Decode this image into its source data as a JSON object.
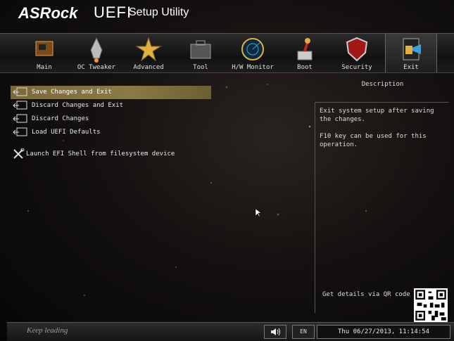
{
  "header": {
    "brand": "ASRock",
    "uefi": "UEFI",
    "subtitle": "Setup Utility"
  },
  "tabs": [
    {
      "label": "Main",
      "icon": "board-icon"
    },
    {
      "label": "OC Tweaker",
      "icon": "rocket-icon"
    },
    {
      "label": "Advanced",
      "icon": "star-icon"
    },
    {
      "label": "Tool",
      "icon": "toolbox-icon"
    },
    {
      "label": "H/W Monitor",
      "icon": "radar-icon"
    },
    {
      "label": "Boot",
      "icon": "joystick-icon"
    },
    {
      "label": "Security",
      "icon": "shield-icon"
    },
    {
      "label": "Exit",
      "icon": "exit-door-icon",
      "active": true
    }
  ],
  "menu": {
    "items": [
      {
        "label": "Save Changes and Exit",
        "icon": "exit-arrow-icon",
        "selected": true
      },
      {
        "label": "Discard Changes and Exit",
        "icon": "exit-arrow-icon"
      },
      {
        "label": "Discard Changes",
        "icon": "exit-arrow-icon"
      },
      {
        "label": "Load UEFI Defaults",
        "icon": "exit-arrow-icon"
      },
      {
        "label": "Launch EFI Shell from filesystem device",
        "icon": "wrench-screwdriver-icon"
      }
    ]
  },
  "description": {
    "title": "Description",
    "line1": "Exit system setup after saving the changes.",
    "line2": "F10 key can be used for this operation.",
    "qr_label": "Get details via QR code"
  },
  "footer": {
    "motto": "Keep leading",
    "speaker_icon": "speaker-icon",
    "language": "EN",
    "datetime": "Thu 06/27/2013, 11:14:54"
  },
  "colors": {
    "accent": "#8a7a45",
    "background": "#141110"
  }
}
